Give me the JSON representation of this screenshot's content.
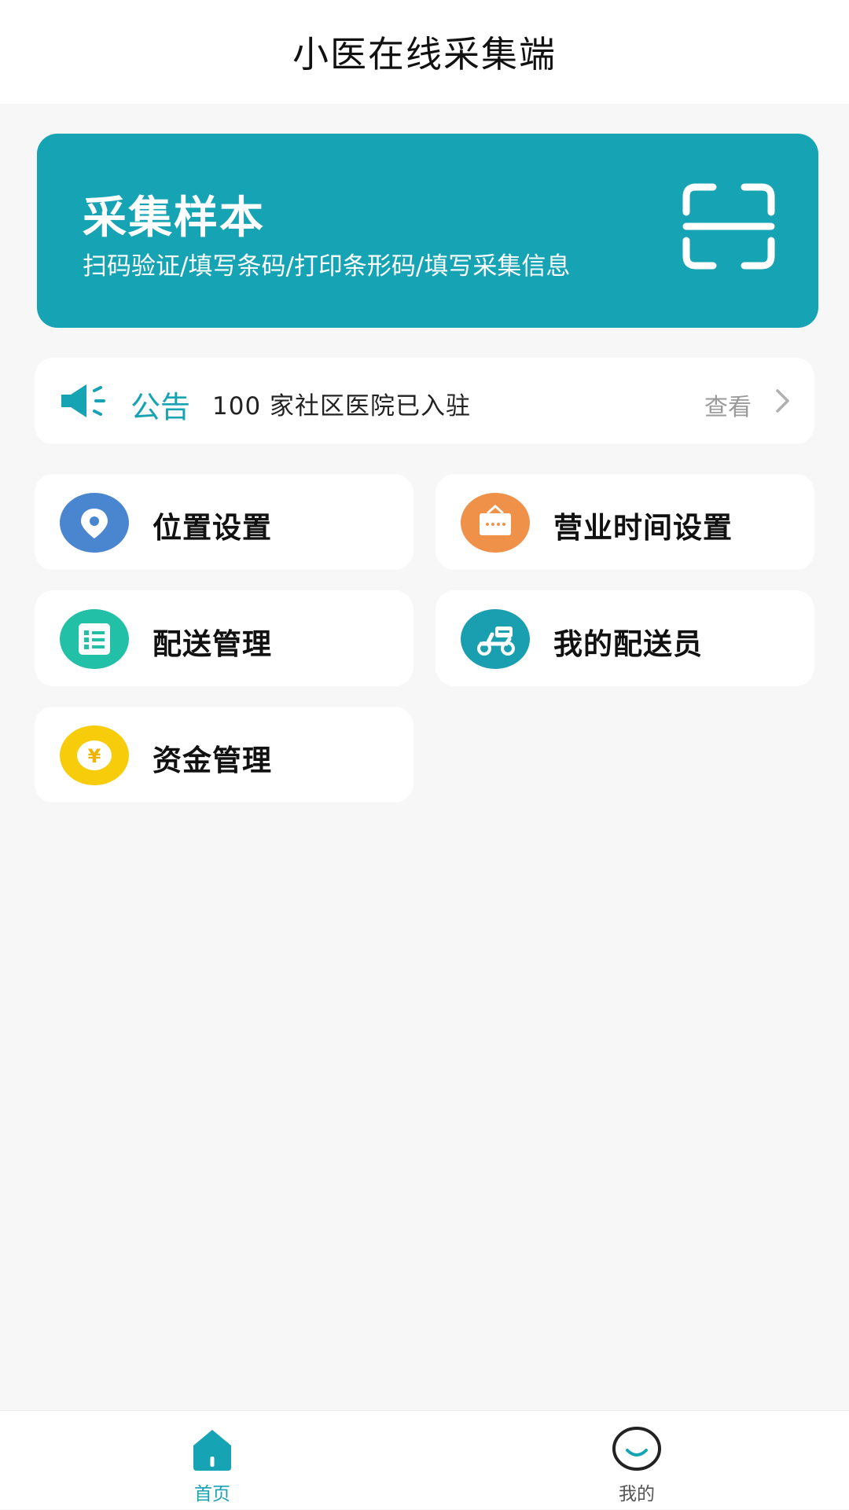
{
  "header": {
    "title": "小医在线采集端"
  },
  "banner": {
    "title": "采集样本",
    "subtitle": "扫码验证/填写条码/打印条形码/填写采集信息",
    "icon": "scan-icon"
  },
  "notice": {
    "label": "公告",
    "text": "100 家社区医院已入驻",
    "view_label": "查看",
    "icon": "speaker-icon"
  },
  "menu": [
    {
      "label": "位置设置",
      "icon": "location-pin-icon",
      "color": "#4a86cf"
    },
    {
      "label": "营业时间设置",
      "icon": "shop-sign-icon",
      "color": "#f0914a"
    },
    {
      "label": "配送管理",
      "icon": "list-icon",
      "color": "#22c0a7"
    },
    {
      "label": "我的配送员",
      "icon": "scooter-icon",
      "color": "#1a9fb0"
    },
    {
      "label": "资金管理",
      "icon": "yuan-coin-icon",
      "color": "#f7cc0b"
    }
  ],
  "tabbar": {
    "items": [
      {
        "label": "首页",
        "icon": "home-icon",
        "active": true
      },
      {
        "label": "我的",
        "icon": "smile-icon",
        "active": false
      }
    ]
  },
  "colors": {
    "accent": "#16a3b4",
    "background": "#f7f7f7"
  }
}
